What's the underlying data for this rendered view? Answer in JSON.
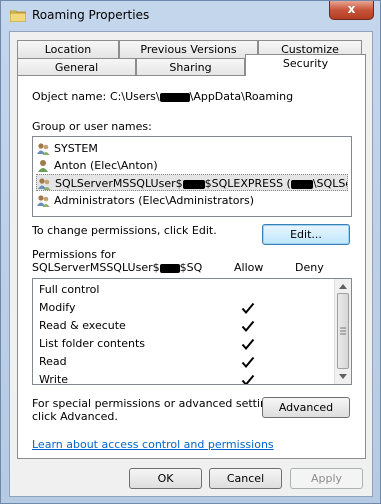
{
  "window": {
    "title": "Roaming Properties",
    "close_glyph": "x"
  },
  "tabs": {
    "row1": [
      "Location",
      "Previous Versions",
      "Customize"
    ],
    "row2": [
      "General",
      "Sharing",
      "Security"
    ],
    "active": "Security"
  },
  "object": {
    "label": "Object name:",
    "path_prefix": "C:\\Users\\",
    "path_suffix": "\\AppData\\Roaming"
  },
  "groups": {
    "label": "Group or user names:",
    "items": [
      {
        "name": "SYSTEM",
        "icon": "group-icon"
      },
      {
        "name": "Anton (Elec\\Anton)",
        "icon": "user-icon"
      },
      {
        "name_prefix": "SQLServerMSSQLUser$",
        "name_mid": "$SQLEXPRESS (",
        "name_suffix": "\\SQLSe...",
        "icon": "group-icon",
        "selected": true
      },
      {
        "name": "Administrators (Elec\\Administrators)",
        "icon": "group-icon"
      }
    ]
  },
  "change_note": "To change permissions, click Edit.",
  "edit_label": "Edit...",
  "permissions": {
    "title_line1": "Permissions for",
    "title_line2_prefix": "SQLServerMSSQLUser$",
    "title_line2_suffix": "$SQ",
    "allow_header": "Allow",
    "deny_header": "Deny",
    "rows": [
      {
        "name": "Full control",
        "allow": false
      },
      {
        "name": "Modify",
        "allow": true
      },
      {
        "name": "Read & execute",
        "allow": true
      },
      {
        "name": "List folder contents",
        "allow": true
      },
      {
        "name": "Read",
        "allow": true
      },
      {
        "name": "Write",
        "allow": true
      }
    ]
  },
  "special": {
    "line1": "For special permissions or advanced settings,",
    "line2": "click Advanced.",
    "advanced_label": "Advanced"
  },
  "learn_link": "Learn about access control and permissions",
  "footer": {
    "ok": "OK",
    "cancel": "Cancel",
    "apply": "Apply"
  }
}
